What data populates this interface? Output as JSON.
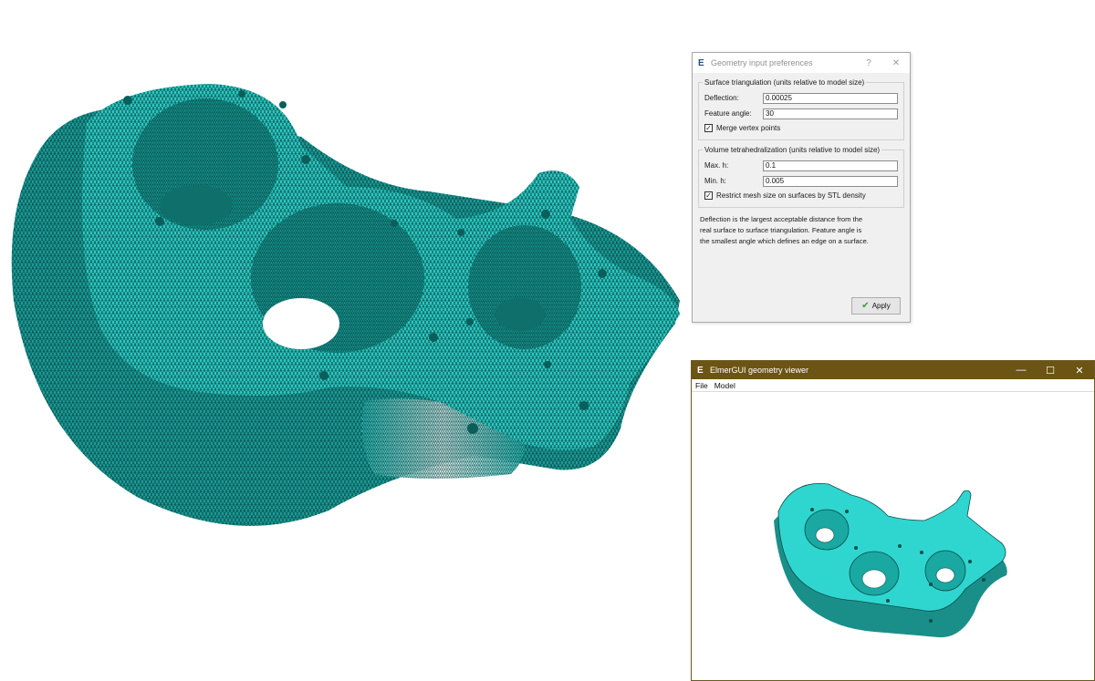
{
  "dialog": {
    "app_icon": "E",
    "title": "Geometry input preferences",
    "help_button": "?",
    "close_button": "✕",
    "surface_group": {
      "legend": "Surface triangulation (units relative to model size)",
      "deflection_label": "Deflection:",
      "deflection_value": "0.00025",
      "feature_angle_label": "Feature angle:",
      "feature_angle_value": "30",
      "merge_label": "Merge vertex points",
      "merge_checked": true
    },
    "volume_group": {
      "legend": "Volume tetrahedralization (units relative to model size)",
      "max_h_label": "Max. h:",
      "max_h_value": "0.1",
      "min_h_label": "Min. h:",
      "min_h_value": "0.005",
      "restrict_label": "Restrict mesh size on surfaces by STL density",
      "restrict_checked": true
    },
    "help_text": [
      "Deflection is the largest acceptable distance from the",
      "real surface to surface triangulation. Feature angle is",
      "the smallest angle which defines an edge on a surface."
    ],
    "apply_label": "Apply"
  },
  "viewer": {
    "app_icon": "E",
    "title": "ElmerGUI geometry viewer",
    "minimize": "—",
    "maximize": "☐",
    "close": "✕",
    "menu": [
      "File",
      "Model"
    ]
  },
  "colors": {
    "mesh": "#29c6c0",
    "mesh_light": "#3ee0da",
    "mesh_dark": "#0f7c78",
    "viewer_titlebar": "#6b5414"
  }
}
